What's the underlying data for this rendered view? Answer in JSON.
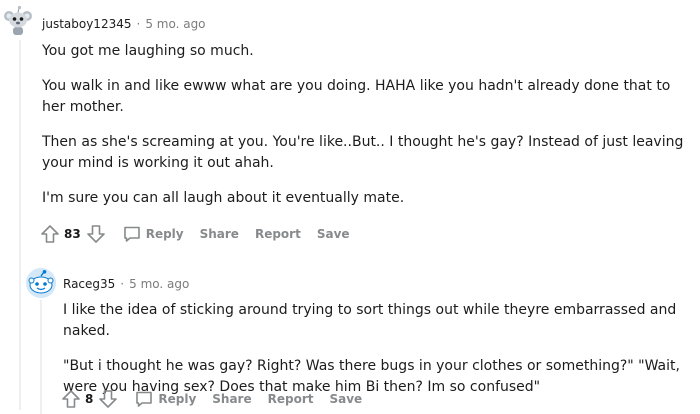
{
  "comments": [
    {
      "username": "justaboy12345",
      "separator": "·",
      "time": "5 mo. ago",
      "paragraphs": [
        "You got me laughing so much.",
        "You walk in and like ewww what are you doing. HAHA like you hadn't already done that to her mother.",
        "Then as she's screaming at you. You're like..But.. I thought he's gay? Instead of just leaving your mind is working it out ahah.",
        "I'm sure you can all laugh about it eventually mate."
      ],
      "votes": "83",
      "actions": {
        "reply": "Reply",
        "share": "Share",
        "report": "Report",
        "save": "Save"
      }
    },
    {
      "username": "Raceg35",
      "separator": "·",
      "time": "5 mo. ago",
      "paragraphs": [
        "I like the idea of sticking around trying to sort things out while theyre embarrassed and naked.",
        "\"But i thought he was gay? Right? Was there bugs in your clothes or something?\" \"Wait, were you having sex? Does that make him Bi then? Im so confused\""
      ],
      "votes": "8",
      "actions": {
        "reply": "Reply",
        "share": "Share",
        "report": "Report",
        "save": "Save"
      }
    }
  ],
  "icons": {
    "upvote": "arrow-up-outline-icon",
    "downvote": "arrow-down-outline-icon",
    "reply": "speech-bubble-icon"
  },
  "colors": {
    "text": "#1c1c1c",
    "muted": "#7c7c7c",
    "action": "#878a8c",
    "thread_line": "#edeff1",
    "avatar2_bg": "#d5e8f8",
    "avatar2_fg": "#0079d3"
  }
}
